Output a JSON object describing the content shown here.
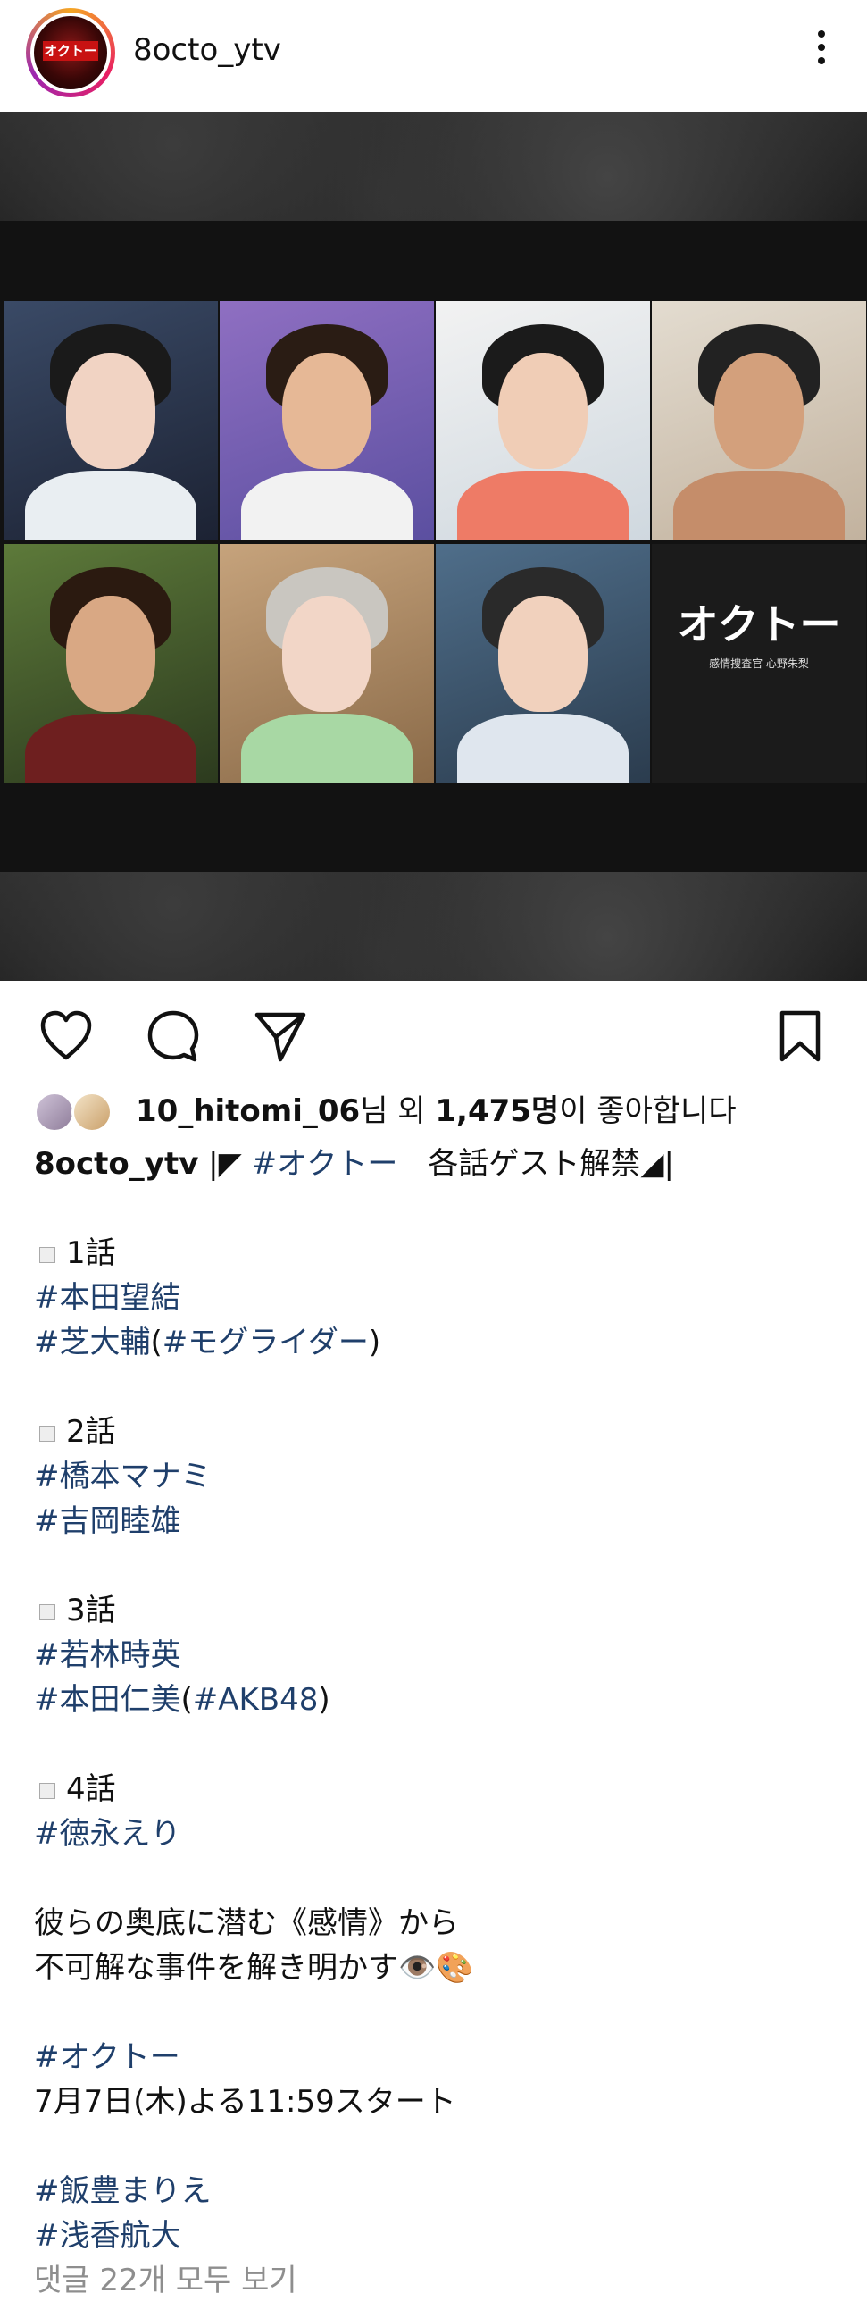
{
  "header": {
    "username": "8octo_ytv",
    "avatar_label": "オクトー"
  },
  "post_image": {
    "title": "オクトー",
    "subtitle": "感情捜査官 心野朱梨"
  },
  "likes": {
    "user": "10_hitomi_06",
    "suffix1": "님 외 ",
    "count": "1,475명",
    "suffix2": "이 좋아합니다"
  },
  "caption": {
    "username": "8octo_ytv",
    "intro_mark1": " |◤ ",
    "intro_tag": "#オクトー",
    "intro_text": "　各話ゲスト解禁◢|",
    "ep1": "1話",
    "ep1_tag1": "#本田望結",
    "ep1_tag2": "#芝大輔",
    "ep1_paren_open": "(",
    "ep1_tag2b": "#モグライダー",
    "ep1_paren_close": ")",
    "ep2": "2話",
    "ep2_tag1": "#橋本マナミ",
    "ep2_tag2": "#吉岡睦雄",
    "ep3": "3話",
    "ep3_tag1": "#若林時英",
    "ep3_tag2": "#本田仁美",
    "ep3_paren_open": "(",
    "ep3_tag2b": "#AKB48",
    "ep3_paren_close": ")",
    "ep4": "4話",
    "ep4_tag1": "#徳永えり",
    "desc1": "彼らの奥底に潜む《感情》から",
    "desc2": "不可解な事件を解き明かす👁️🎨",
    "show_tag": "#オクトー",
    "airtime": "7月7日(木)よる11:59スタート",
    "cast_tag1": "#飯豊まりえ",
    "cast_tag2": "#浅香航大"
  },
  "comments_link": "댓글 22개 모두 보기"
}
